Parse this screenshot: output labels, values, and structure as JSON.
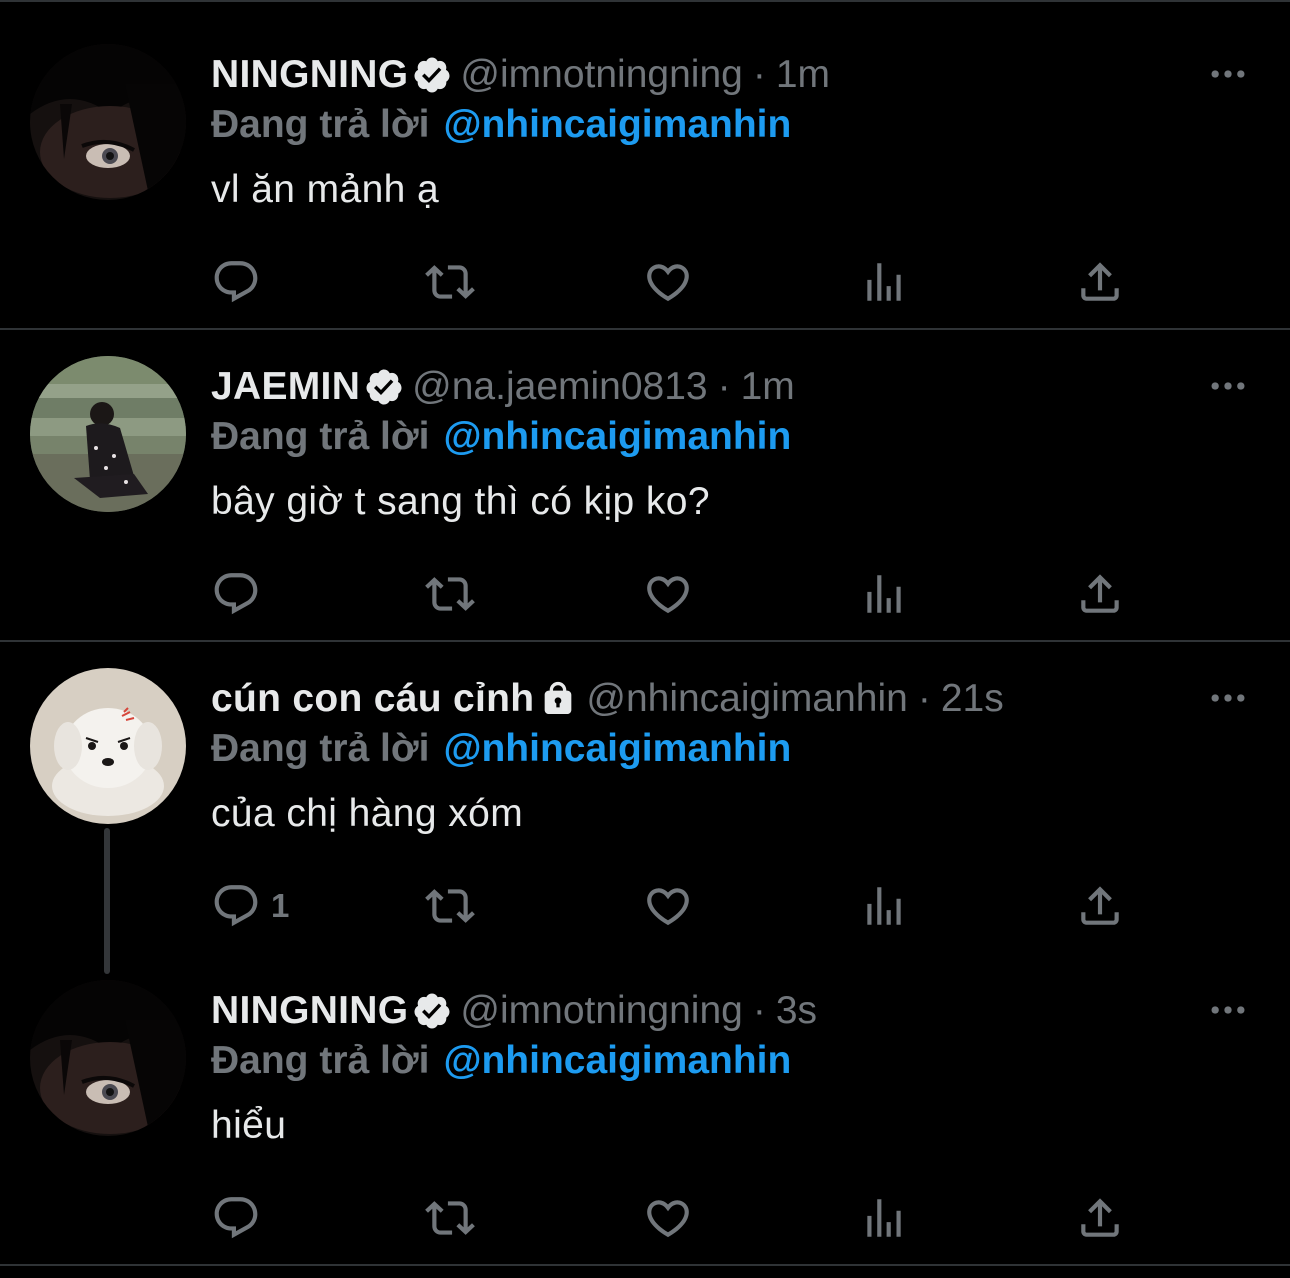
{
  "theme": {
    "background": "#000000",
    "divider": "#2f3336",
    "text_primary": "#e7e9ea",
    "text_secondary": "#71767b",
    "link": "#1d9bf0"
  },
  "tweets": [
    {
      "display_name": "NINGNING",
      "badge": "verified-icon",
      "handle": "@imnotningning",
      "separator": "·",
      "time": "1m",
      "reply_prefix": "Đang trả lời",
      "reply_to": "@nhincaigimanhin",
      "text": "vl ăn mảnh ạ",
      "reply_count": ""
    },
    {
      "display_name": "JAEMIN",
      "badge": "verified-icon",
      "handle": "@na.jaemin0813",
      "separator": "·",
      "time": "1m",
      "reply_prefix": "Đang trả lời",
      "reply_to": "@nhincaigimanhin",
      "text": "bây giờ t sang thì có kịp ko?",
      "reply_count": ""
    },
    {
      "display_name": "cún con cáu cỉnh",
      "badge": "lock-icon",
      "handle": "@nhincaigimanhin",
      "separator": "·",
      "time": "21s",
      "reply_prefix": "Đang trả lời",
      "reply_to": "@nhincaigimanhin",
      "text": "của chị hàng xóm",
      "reply_count": "1"
    },
    {
      "display_name": "NINGNING",
      "badge": "verified-icon",
      "handle": "@imnotningning",
      "separator": "·",
      "time": "3s",
      "reply_prefix": "Đang trả lời",
      "reply_to": "@nhincaigimanhin",
      "text": "hiểu",
      "reply_count": ""
    }
  ],
  "actions": [
    "reply-icon",
    "retweet-icon",
    "like-icon",
    "views-icon",
    "share-icon"
  ]
}
